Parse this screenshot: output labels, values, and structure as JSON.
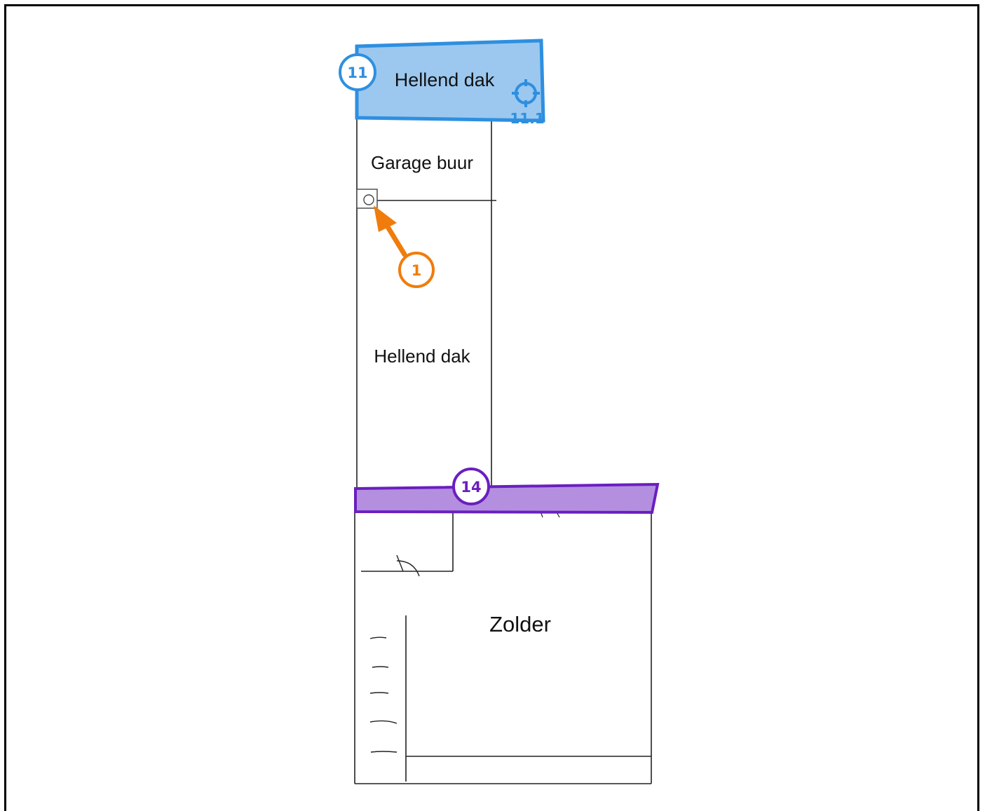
{
  "colors": {
    "roof_fill": "#9cc8ef",
    "roof_stroke": "#2e8fe0",
    "roof_text": "#1f4f80",
    "wall_fill": "#b48fe0",
    "wall_stroke": "#6a1fbf",
    "marker_orange": "#f07c0c",
    "line": "#222222"
  },
  "rooms": {
    "roof_top": "Hellend dak",
    "garage": "Garage buur",
    "roof_middle": "Hellend dak",
    "attic": "Zolder"
  },
  "annotations": {
    "roof_badge": "11",
    "roof_sub_marker": "11.1",
    "wall_badge": "14",
    "point_badge": "1"
  },
  "icons": {
    "roof_target": "crosshair-icon",
    "pointer_arrow": "arrow-icon"
  }
}
